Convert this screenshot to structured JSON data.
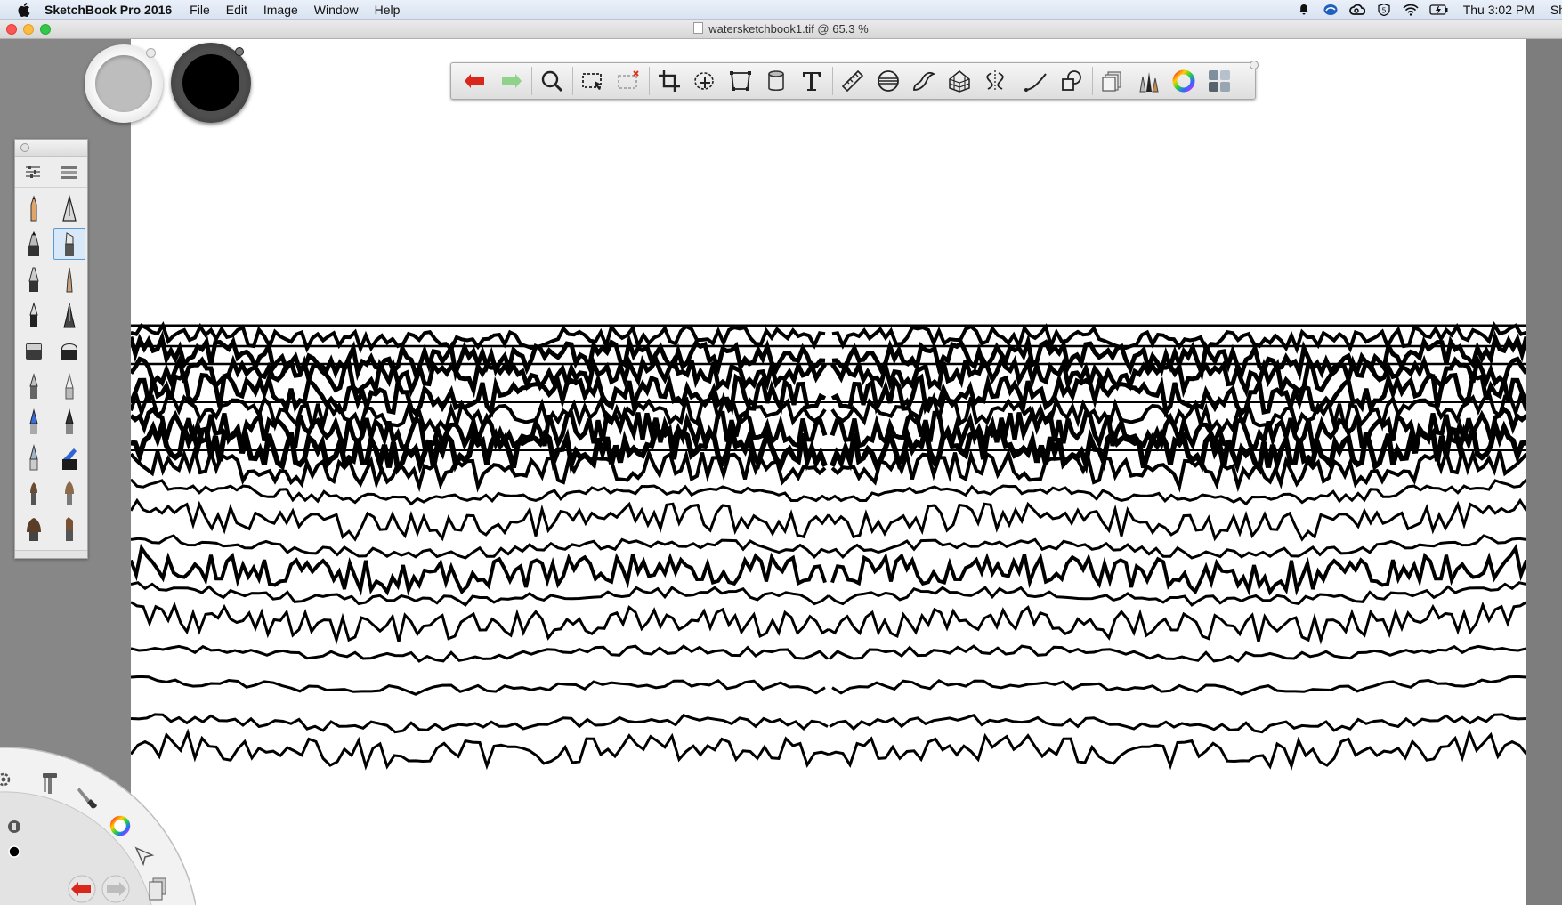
{
  "menubar": {
    "app_name": "SketchBook Pro 2016",
    "menus": [
      "File",
      "Edit",
      "Image",
      "Window",
      "Help"
    ],
    "clock": "Thu 3:02 PM",
    "user": "Sh",
    "status_icons": [
      "notification-bell-icon",
      "app-swirl-icon",
      "creative-cloud-icon",
      "shield-5-icon",
      "wifi-icon",
      "battery-charging-icon"
    ]
  },
  "window": {
    "title": "watersketchbook1.tif @ 65.3 %"
  },
  "toolbar": {
    "tools": [
      "undo-icon",
      "redo-icon",
      "zoom-icon",
      "rect-select-icon",
      "deselect-icon",
      "crop-icon",
      "lasso-transform-icon",
      "distort-icon",
      "fill-icon",
      "text-icon",
      "ruler-icon",
      "ellipse-icon",
      "french-curve-icon",
      "perspective-icon",
      "symmetry-icon",
      "stroke-icon",
      "shapes-icon",
      "layers-icon",
      "brushes-icon",
      "color-wheel-icon",
      "copic-library-icon"
    ]
  },
  "colors": {
    "accent": "#e0321f",
    "primary_color": "#000000",
    "secondary_color": "#bdbdbd"
  }
}
